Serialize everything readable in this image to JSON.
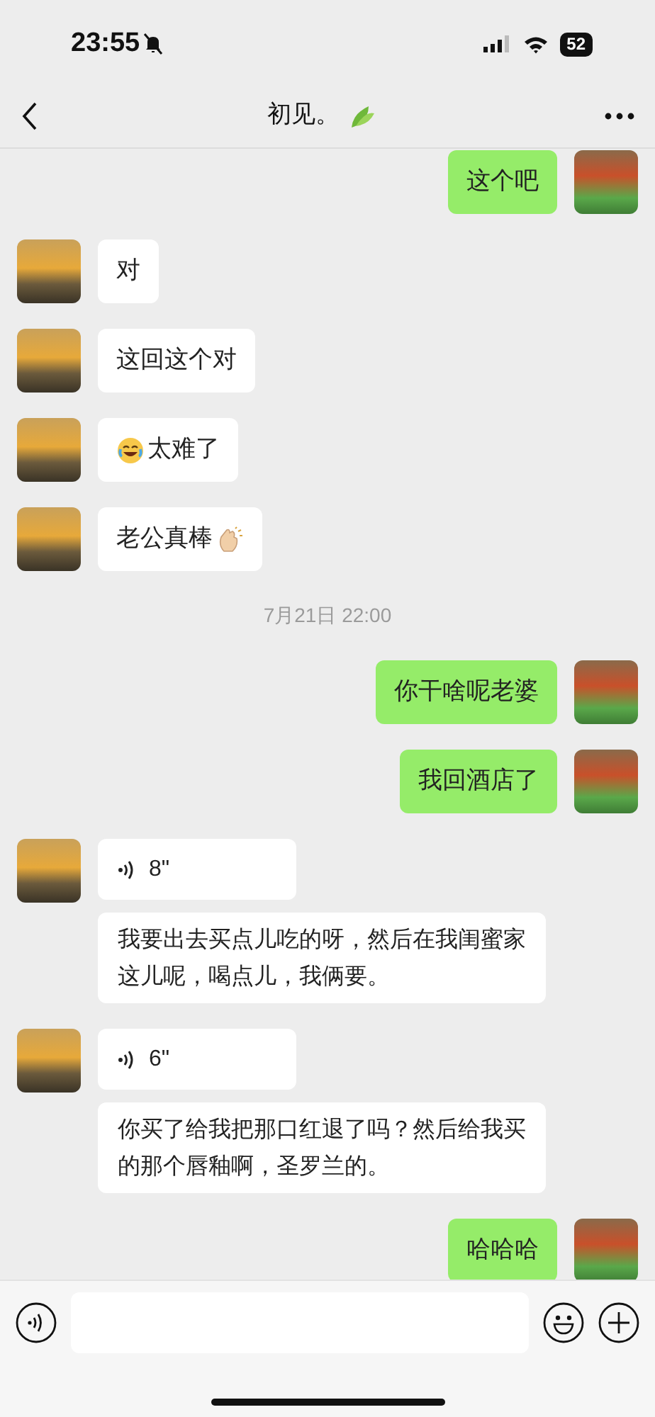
{
  "status_bar": {
    "time": "23:55",
    "muted": true,
    "battery": "52"
  },
  "header": {
    "title": "初见。"
  },
  "messages": [
    {
      "kind": "text",
      "outgoing": true,
      "parts": [
        {
          "kind": "text",
          "text": "这个吧"
        }
      ]
    },
    {
      "kind": "text",
      "outgoing": false,
      "parts": [
        {
          "kind": "text",
          "text": "对"
        }
      ]
    },
    {
      "kind": "text",
      "outgoing": false,
      "parts": [
        {
          "kind": "text",
          "text": "这回这个对"
        }
      ]
    },
    {
      "kind": "text",
      "outgoing": false,
      "parts": [
        {
          "kind": "laughing-face"
        },
        {
          "kind": "text",
          "text": "太难了"
        }
      ]
    },
    {
      "kind": "text",
      "outgoing": false,
      "parts": [
        {
          "kind": "text",
          "text": "老公真棒"
        },
        {
          "kind": "clapping-hands"
        }
      ]
    },
    {
      "kind": "time",
      "text": "7月21日 22:00"
    },
    {
      "kind": "text",
      "outgoing": true,
      "parts": [
        {
          "kind": "text",
          "text": "你干啥呢老婆"
        }
      ]
    },
    {
      "kind": "text",
      "outgoing": true,
      "parts": [
        {
          "kind": "text",
          "text": "我回酒店了"
        }
      ]
    },
    {
      "kind": "voice",
      "outgoing": false,
      "duration": "8\"",
      "transcript": "我要出去买点儿吃的呀，然后在我闺蜜家这儿呢，喝点儿，我俩要。"
    },
    {
      "kind": "voice",
      "outgoing": false,
      "duration": "6\"",
      "transcript": "你买了给我把那口红退了吗？然后给我买的那个唇釉啊，圣罗兰的。"
    },
    {
      "kind": "text",
      "outgoing": true,
      "parts": [
        {
          "kind": "text",
          "text": "哈哈哈"
        }
      ]
    }
  ]
}
